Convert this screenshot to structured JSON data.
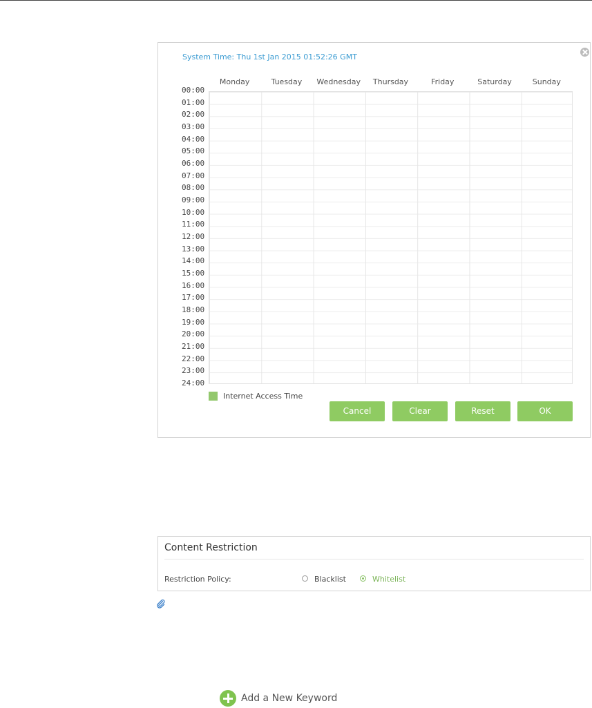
{
  "schedule": {
    "system_time": "System Time: Thu 1st Jan 2015 01:52:26 GMT",
    "days": [
      "Monday",
      "Tuesday",
      "Wednesday",
      "Thursday",
      "Friday",
      "Saturday",
      "Sunday"
    ],
    "hours": [
      "00:00",
      "01:00",
      "02:00",
      "03:00",
      "04:00",
      "05:00",
      "06:00",
      "07:00",
      "08:00",
      "09:00",
      "10:00",
      "11:00",
      "12:00",
      "13:00",
      "14:00",
      "15:00",
      "16:00",
      "17:00",
      "18:00",
      "19:00",
      "20:00",
      "21:00",
      "22:00",
      "23:00",
      "24:00"
    ],
    "legend_label": "Internet Access Time",
    "legend_color": "#93c86d",
    "buttons": {
      "cancel": "Cancel",
      "clear": "Clear",
      "reset": "Reset",
      "ok": "OK"
    }
  },
  "content_restriction": {
    "title": "Content Restriction",
    "policy_label": "Restriction Policy:",
    "options": {
      "blacklist": "Blacklist",
      "whitelist": "Whitelist"
    },
    "selected": "whitelist"
  },
  "add_keyword": {
    "label": "Add a New Keyword"
  },
  "colors": {
    "accent": "#8fcb62",
    "link": "#3a9bd2"
  }
}
